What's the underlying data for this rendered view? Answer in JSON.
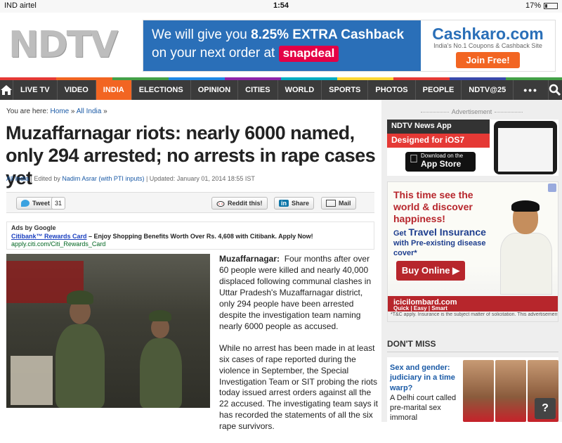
{
  "status_bar": {
    "carrier": "IND airtel",
    "time": "1:54",
    "battery": "17%",
    "battery_level": 0.17
  },
  "header": {
    "logo_text": "NDTV",
    "banner": {
      "line1_prefix": "We will give you ",
      "line1_bold": "8.25% EXTRA Cashback",
      "line2": "on your next order at ",
      "partner": "snapdeal",
      "brand": "Cashkaro.com",
      "tagline": "India's No.1 Coupons & Cashback Site",
      "cta": "Join Free!"
    }
  },
  "nav": {
    "stripe_colors": [
      "#e53935",
      "#f26522",
      "#43a047",
      "#1e88e5",
      "#8e24aa",
      "#00acc1",
      "#fdd835",
      "#e53935",
      "#3949ab",
      "#43a047"
    ],
    "items": [
      "LIVE TV",
      "VIDEO",
      "INDIA",
      "ELECTIONS",
      "OPINION",
      "CITIES",
      "WORLD",
      "SPORTS",
      "PHOTOS",
      "PEOPLE",
      "NDTV@25"
    ],
    "active": "INDIA",
    "more": "•••"
  },
  "article": {
    "breadcrumb": {
      "prefix": "You are here: ",
      "home": "Home",
      "sep": " » ",
      "section": "All India",
      "suffix": " »"
    },
    "headline": "Muzaffarnagar riots: nearly 6000 named, only 294 arrested; no arrests in rape cases yet",
    "meta": {
      "section": "All India",
      "edited_by_prefix": " | Edited by ",
      "editor": "Nadim Asrar (with PTI inputs)",
      "updated": " | Updated: January 01, 2014 18:55 IST"
    },
    "share": {
      "tweet": "Tweet",
      "tweet_count": "31",
      "reddit": "Reddit this!",
      "linkedin": "Share",
      "mail": "Mail"
    },
    "ad": {
      "label": "Ads by Google",
      "link": "Citibank™ Rewards Card",
      "text": " – Enjoy Shopping Benefits Worth Over Rs. 4,608 with Citibank. Apply Now!",
      "url": "apply.citi.com/Citi_Rewards_Card"
    },
    "lead_place": "Muzaffarnagar:",
    "para1": "Four months after over 60 people were killed and nearly 40,000 displaced following communal clashes in Uttar Pradesh's Muzaffarnagar district, only 294 people have been arrested despite the investigation team naming nearly 6000 people as accused.",
    "para2": "While no arrest has been made in at least six cases of rape reported during the violence in September, the Special Investigation Team or SIT probing the riots today issued arrest orders against all the 22 accused. The investigating team says it has recorded the statements of all the six rape survivors."
  },
  "sidebar": {
    "adv_label": "Advertisement",
    "ios_ad": {
      "line1": "NDTV News App",
      "line2": "Designed for iOS7",
      "store_small": "Download on the",
      "store_big": "App Store"
    },
    "icici_ad": {
      "headline": "This time see the world & discover happiness!",
      "subtext_prefix": "Get ",
      "subtext_bold": "Travel Insurance",
      "subtext_suffix": " with Pre-existing disease cover*",
      "cta": "Buy Online ▶",
      "brand": "icicilombard.com",
      "brand_sub": "Quick | Easy | Smart",
      "disclaimer": "*T&C apply. Insurance is the subject matter of solicitation. This advertisement"
    },
    "dont_miss": {
      "title": "DON'T MISS",
      "headline": "Sex and gender: judiciary in a time warp?",
      "text": "A Delhi court called pre-marital sex immoral",
      "help": "?"
    }
  }
}
